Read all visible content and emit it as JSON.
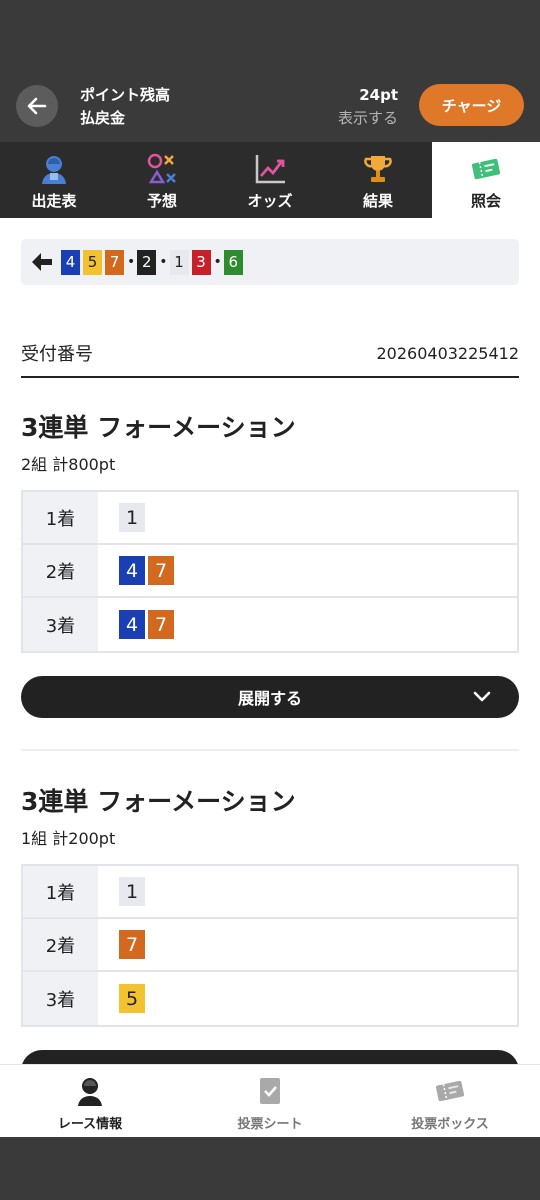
{
  "header": {
    "point_label": "ポイント残高",
    "refund_label": "払戻金",
    "point_value": "24pt",
    "refund_value": "表示する",
    "charge_label": "チャージ"
  },
  "tabs": [
    {
      "label": "出走表",
      "icon": "racer-icon"
    },
    {
      "label": "予想",
      "icon": "prediction-icon"
    },
    {
      "label": "オッズ",
      "icon": "odds-chart-icon"
    },
    {
      "label": "結果",
      "icon": "trophy-icon"
    },
    {
      "label": "照会",
      "icon": "ticket-icon",
      "active": true
    }
  ],
  "combo": {
    "group1": [
      "4",
      "5",
      "7"
    ],
    "group2": [
      "2"
    ],
    "group3": [
      "1",
      "3"
    ],
    "group4": [
      "6"
    ]
  },
  "receipt": {
    "label": "受付番号",
    "value": "20260403225412"
  },
  "bets": [
    {
      "title": "3連単 フォーメーション",
      "sub": "2組 計800pt",
      "rows": [
        {
          "label": "1着",
          "nums": [
            "1"
          ]
        },
        {
          "label": "2着",
          "nums": [
            "4",
            "7"
          ]
        },
        {
          "label": "3着",
          "nums": [
            "4",
            "7"
          ]
        }
      ],
      "expand_label": "展開する"
    },
    {
      "title": "3連単 フォーメーション",
      "sub": "1組 計200pt",
      "rows": [
        {
          "label": "1着",
          "nums": [
            "1"
          ]
        },
        {
          "label": "2着",
          "nums": [
            "7"
          ]
        },
        {
          "label": "3着",
          "nums": [
            "5"
          ]
        }
      ]
    }
  ],
  "bottom_nav": [
    {
      "label": "レース情報",
      "active": true
    },
    {
      "label": "投票シート"
    },
    {
      "label": "投票ボックス"
    }
  ],
  "colors": {
    "lane1": "#e8e9ee",
    "lane2": "#222222",
    "lane3": "#c8202b",
    "lane4": "#1a3fb5",
    "lane5": "#f2c230",
    "lane6": "#2e8b2e",
    "lane7": "#d2691e",
    "accent": "#e0782a"
  }
}
